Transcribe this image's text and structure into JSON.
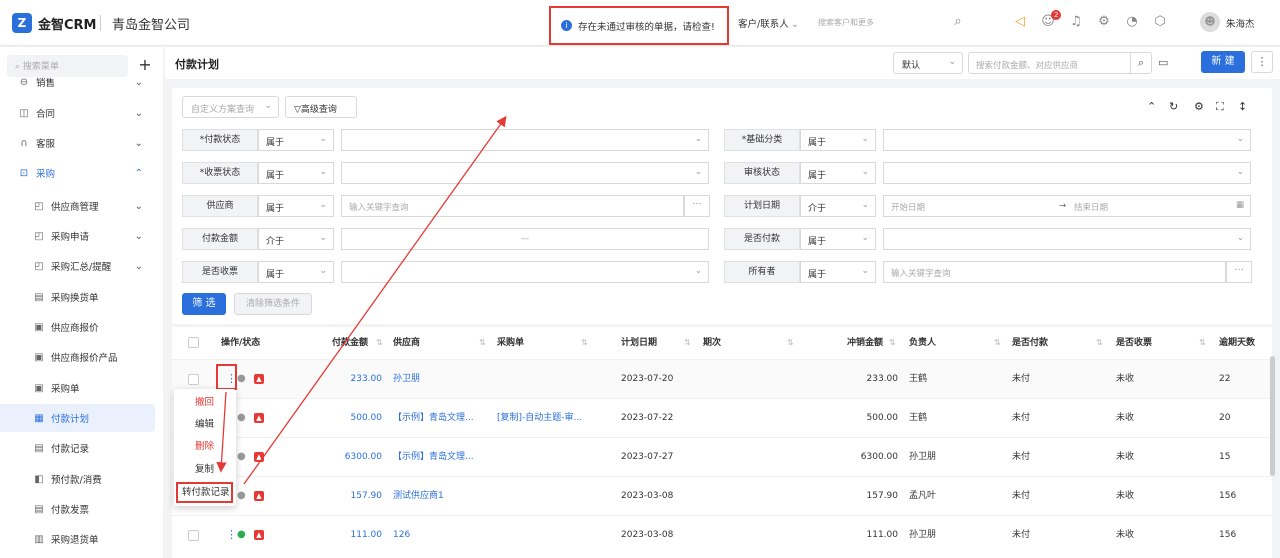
{
  "topbar": {
    "brand": "金智CRM",
    "company": "青岛金智公司",
    "alert_text": "存在未通过审核的单据，请检查!",
    "scope": "客户/联系人",
    "search_placeholder": "搜索客户和更多",
    "notification_count": "2",
    "username": "朱海杰"
  },
  "sidebar": {
    "search_placeholder": "搜索菜单",
    "items": [
      {
        "label": "销售",
        "level": "top"
      },
      {
        "label": "合同",
        "level": "top"
      },
      {
        "label": "客服",
        "level": "top"
      },
      {
        "label": "采购",
        "level": "top"
      },
      {
        "label": "供应商管理",
        "level": "sub"
      },
      {
        "label": "采购申请",
        "level": "sub"
      },
      {
        "label": "采购汇总/提醒",
        "level": "sub"
      },
      {
        "label": "采购换货单",
        "level": "sub"
      },
      {
        "label": "供应商报价",
        "level": "sub"
      },
      {
        "label": "供应商报价产品",
        "level": "sub"
      },
      {
        "label": "采购单",
        "level": "sub"
      },
      {
        "label": "付款计划",
        "level": "sub"
      },
      {
        "label": "付款记录",
        "level": "sub"
      },
      {
        "label": "预付款/消费",
        "level": "sub"
      },
      {
        "label": "付款发票",
        "level": "sub"
      },
      {
        "label": "采购退货单",
        "level": "sub"
      }
    ]
  },
  "page": {
    "title": "付款计划",
    "view_select": "默认",
    "search_placeholder": "搜索付款金额、对应供应商",
    "new_button": "新 建"
  },
  "filter": {
    "scheme_placeholder": "自定义方案查询",
    "advanced": "高级查询",
    "left": [
      {
        "label": "*付款状态",
        "op": "属于",
        "value": ""
      },
      {
        "label": "*收票状态",
        "op": "属于",
        "value": ""
      },
      {
        "label": "供应商",
        "op": "属于",
        "value": "输入关键字查询"
      },
      {
        "label": "付款金额",
        "op": "介于",
        "value": "—"
      },
      {
        "label": "是否收票",
        "op": "属于",
        "value": ""
      }
    ],
    "right": [
      {
        "label": "*基础分类",
        "op": "属于",
        "value": ""
      },
      {
        "label": "审核状态",
        "op": "属于",
        "value": ""
      },
      {
        "label": "计划日期",
        "op": "介于",
        "start": "开始日期",
        "arrow": "→",
        "end": "结束日期"
      },
      {
        "label": "是否付款",
        "op": "属于",
        "value": ""
      },
      {
        "label": "所有者",
        "op": "属于",
        "value": "输入关键字查询"
      }
    ],
    "filter_button": "筛 选",
    "clear_button": "清除筛选条件"
  },
  "table": {
    "headers": [
      "操作/状态",
      "付款金额",
      "供应商",
      "采购单",
      "计划日期",
      "期次",
      "冲销金额",
      "负责人",
      "是否付款",
      "是否收票",
      "逾期天数"
    ],
    "rows": [
      {
        "amount": "233.00",
        "supplier": "孙卫朋",
        "po": "",
        "date": "2023-07-20",
        "term": "",
        "offset": "233.00",
        "owner": "王鹤",
        "paid": "未付",
        "invoiced": "未收",
        "overdue": "22"
      },
      {
        "amount": "500.00",
        "supplier": "【示例】青岛文理...",
        "po": "[复制]-自动主题-审...",
        "date": "2023-07-22",
        "term": "",
        "offset": "500.00",
        "owner": "王鹤",
        "paid": "未付",
        "invoiced": "未收",
        "overdue": "20"
      },
      {
        "amount": "6300.00",
        "supplier": "【示例】青岛文理...",
        "po": "",
        "date": "2023-07-27",
        "term": "",
        "offset": "6300.00",
        "owner": "孙卫朋",
        "paid": "未付",
        "invoiced": "未收",
        "overdue": "15"
      },
      {
        "amount": "157.90",
        "supplier": "测试供应商1",
        "po": "",
        "date": "2023-03-08",
        "term": "",
        "offset": "157.90",
        "owner": "孟凡叶",
        "paid": "未付",
        "invoiced": "未收",
        "overdue": "156"
      },
      {
        "amount": "111.00",
        "supplier": "126",
        "po": "",
        "date": "2023-03-08",
        "term": "",
        "offset": "111.00",
        "owner": "孙卫朋",
        "paid": "未付",
        "invoiced": "未收",
        "overdue": "156"
      }
    ]
  },
  "context_menu": {
    "items": [
      "撤回",
      "编辑",
      "删除",
      "复制",
      "转付款记录"
    ]
  },
  "colors": {
    "accent": "#2a6fdb",
    "danger": "#e53935"
  }
}
